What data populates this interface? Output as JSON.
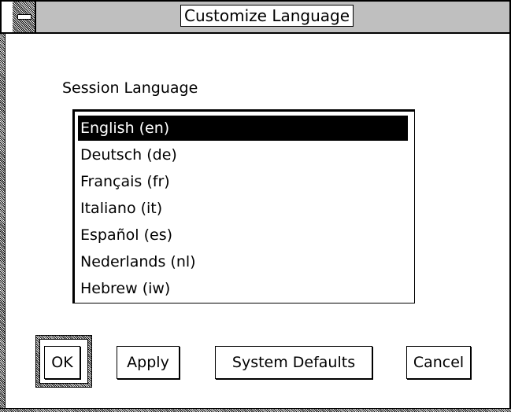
{
  "window": {
    "title": "Customize Language"
  },
  "session": {
    "label": "Session Language"
  },
  "languages": [
    {
      "label": "English (en)",
      "selected": true
    },
    {
      "label": "Deutsch (de)",
      "selected": false
    },
    {
      "label": "Français (fr)",
      "selected": false
    },
    {
      "label": "Italiano (it)",
      "selected": false
    },
    {
      "label": "Español (es)",
      "selected": false
    },
    {
      "label": "Nederlands (nl)",
      "selected": false
    },
    {
      "label": "Hebrew (iw)",
      "selected": false
    }
  ],
  "buttons": {
    "ok": "OK",
    "apply": "Apply",
    "system_defaults": "System Defaults",
    "cancel": "Cancel"
  },
  "colors": {
    "selection_bg": "#000000",
    "selection_fg": "#ffffff",
    "background": "#ffffff"
  },
  "icons": {
    "window_menu": "window-menu-icon"
  }
}
